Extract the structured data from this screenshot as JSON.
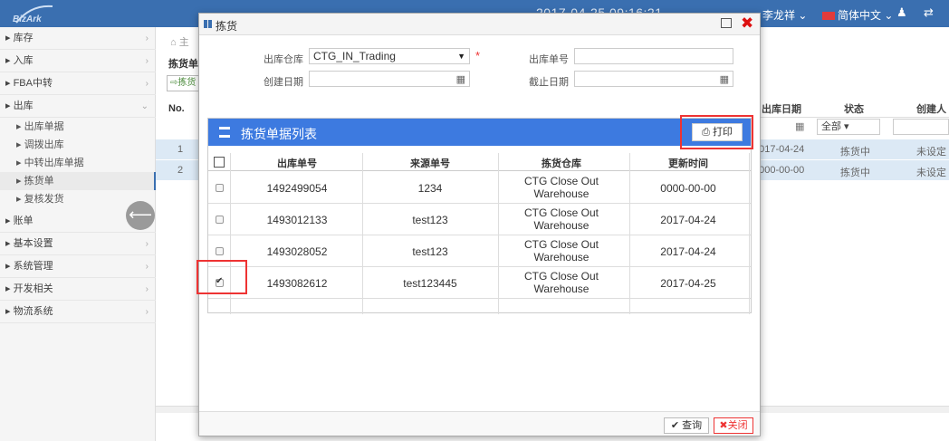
{
  "topbar": {
    "logo_text": "BizArk",
    "datetime": "2017-04-25 09:16:21",
    "user": "李龙祥 ⌄",
    "language": "简体中文 ⌄"
  },
  "sidebar": {
    "items": [
      {
        "label": "库存"
      },
      {
        "label": "入库"
      },
      {
        "label": "FBA中转"
      },
      {
        "label": "出库"
      },
      {
        "label": "账单"
      },
      {
        "label": "基本设置"
      },
      {
        "label": "系统管理"
      },
      {
        "label": "开发相关"
      },
      {
        "label": "物流系统"
      }
    ],
    "sub_items": [
      {
        "label": "出库单据"
      },
      {
        "label": "调拨出库"
      },
      {
        "label": "中转出库单据"
      },
      {
        "label": "拣货单"
      },
      {
        "label": "复核发货"
      }
    ]
  },
  "background": {
    "breadcrumb": "主",
    "page_title": "拣货单",
    "action_label": "拣货",
    "columns": {
      "no": "No.",
      "date": "出库日期",
      "status": "状态",
      "creator": "创建人"
    },
    "status_filter": "全部",
    "rows": [
      {
        "no": "1",
        "date": "2017-04-24",
        "status": "拣货中",
        "creator": "未设定"
      },
      {
        "no": "2",
        "date": "0000-00-00",
        "status": "拣货中",
        "creator": "未设定"
      }
    ]
  },
  "modal": {
    "title": "拣货",
    "form": {
      "warehouse_label": "出库仓库",
      "warehouse_value": "CTG_IN_Trading",
      "order_no_label": "出库单号",
      "created_label": "创建日期",
      "deadline_label": "截止日期"
    },
    "panel_title": "拣货单据列表",
    "print_label": "打印",
    "table": {
      "headers": [
        "出库单号",
        "来源单号",
        "拣货仓库",
        "更新时间"
      ],
      "rows": [
        {
          "order": "1492499054",
          "source": "1234",
          "warehouse_l1": "CTG Close Out",
          "warehouse_l2": "Warehouse",
          "updated": "0000-00-00",
          "checked": false
        },
        {
          "order": "1493012133",
          "source": "test123",
          "warehouse_l1": "CTG Close Out",
          "warehouse_l2": "Warehouse",
          "updated": "2017-04-24",
          "checked": false
        },
        {
          "order": "1493028052",
          "source": "test123",
          "warehouse_l1": "CTG Close Out",
          "warehouse_l2": "Warehouse",
          "updated": "2017-04-24",
          "checked": false
        },
        {
          "order": "1493082612",
          "source": "test123445",
          "warehouse_l1": "CTG Close Out",
          "warehouse_l2": "Warehouse",
          "updated": "2017-04-25",
          "checked": true
        }
      ]
    },
    "query_label": "查询",
    "close_label": "关闭"
  },
  "colors": {
    "topbar": "#3a6fb0",
    "panel_header": "#3d7ae0",
    "highlight_row": "#dce9f5",
    "annotation_red": "#e33333"
  }
}
